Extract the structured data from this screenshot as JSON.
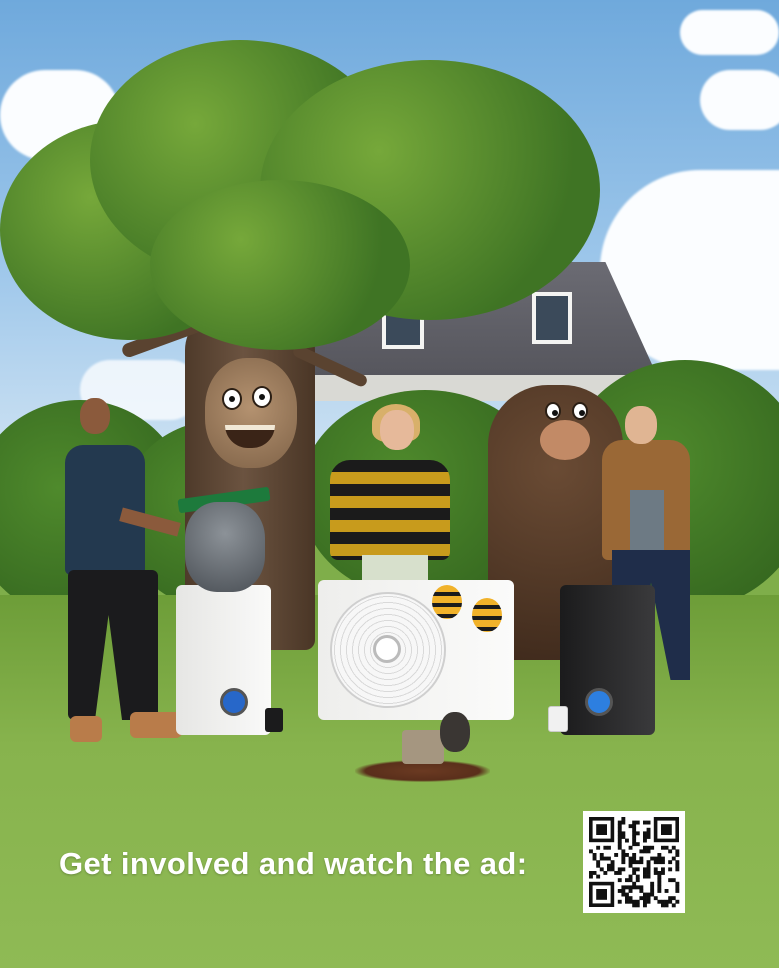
{
  "scene": {
    "sky": "sky-with-clouds",
    "setting": "suburban-garden-lawn"
  },
  "characters": [
    {
      "name": "man-in-navy-shirt"
    },
    {
      "name": "talking-tree-with-face"
    },
    {
      "name": "racoon-plush-on-boiler"
    },
    {
      "name": "woman-in-bee-striped-sweater"
    },
    {
      "name": "person-in-bear-costume"
    },
    {
      "name": "man-in-brown-jacket"
    },
    {
      "name": "mole-with-radio"
    },
    {
      "name": "bee-figures"
    }
  ],
  "products": [
    {
      "name": "white-wall-boiler"
    },
    {
      "name": "white-heat-pump"
    },
    {
      "name": "black-wall-boiler"
    }
  ],
  "cta": {
    "text": "Get involved and watch the ad:"
  },
  "colors": {
    "cta_text": "#ffffff",
    "lawn": "#87b34d",
    "sky": "#8fbfe6"
  },
  "icons": {
    "qr": "qr-code-icon"
  }
}
